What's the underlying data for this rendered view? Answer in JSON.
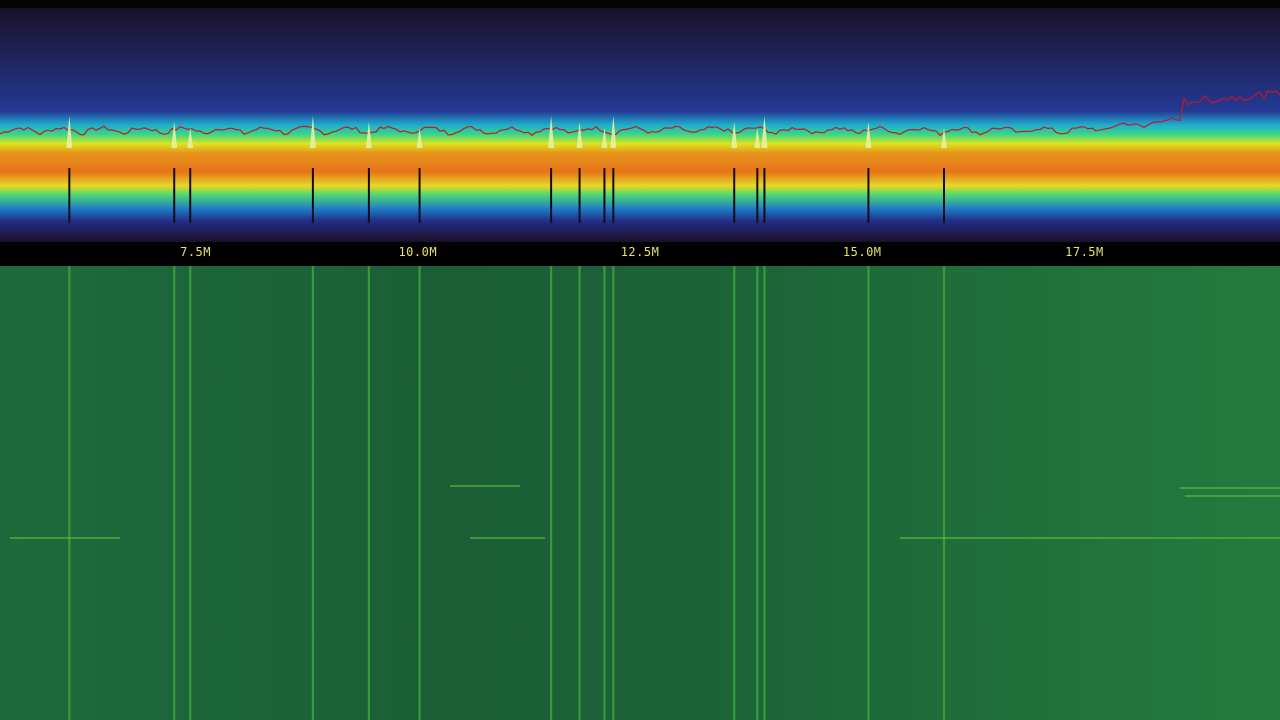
{
  "app": {
    "view": "spectrum-waterfall"
  },
  "frequency_axis": {
    "unit": "Hz",
    "min_mhz": 5.3,
    "max_mhz": 19.7,
    "ticks": [
      {
        "mhz": 7.5,
        "label": "7.5M"
      },
      {
        "mhz": 10.0,
        "label": "10.0M"
      },
      {
        "mhz": 12.5,
        "label": "12.5M"
      },
      {
        "mhz": 15.0,
        "label": "15.0M"
      },
      {
        "mhz": 17.5,
        "label": "17.5M"
      }
    ]
  },
  "signals_mhz": [
    6.08,
    7.26,
    7.44,
    8.82,
    9.45,
    10.02,
    11.5,
    11.82,
    12.1,
    12.2,
    13.56,
    13.82,
    13.9,
    15.07,
    15.92
  ],
  "colors": {
    "spectrum_bg": "#1a1128",
    "peak_hold": "#c0182a",
    "waterfall_base": "#1f6b3a",
    "tick_label": "#e8e26a",
    "grid": "#2a2435"
  }
}
